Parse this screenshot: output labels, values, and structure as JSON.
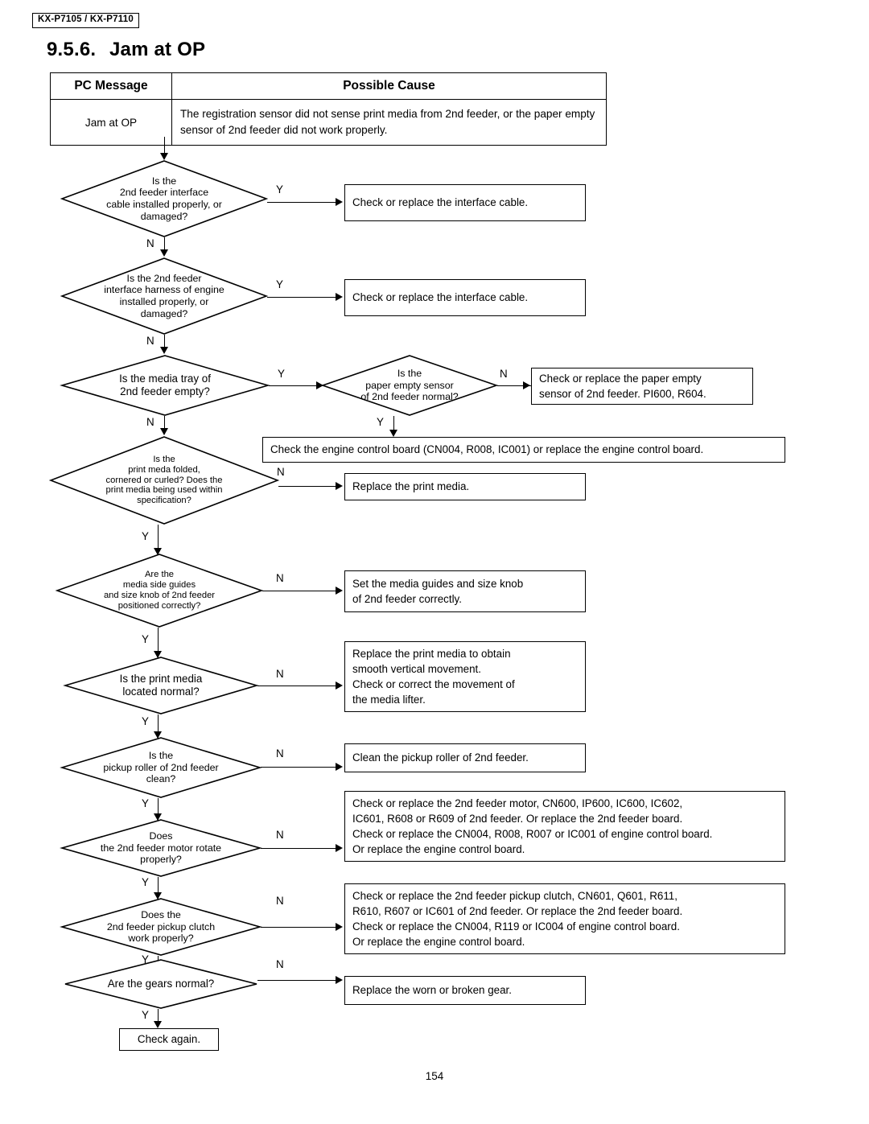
{
  "header": {
    "model_left": "KX-P7105",
    "model_sep": "/",
    "model_right": "KX-P7110",
    "section_number": "9.5.6.",
    "section_title": "Jam at OP"
  },
  "table": {
    "columns": [
      "PC Message",
      "Possible Cause"
    ],
    "rows": [
      {
        "pc_message": "Jam at OP",
        "possible_cause": "The registration sensor did not sense print media from 2nd feeder, or the paper empty sensor of 2nd feeder did not work properly."
      }
    ]
  },
  "flow": {
    "yes_label": "Y",
    "no_label": "N",
    "decisions": [
      {
        "id": "d1",
        "text": "Is the\n2nd feeder interface\ncable installed properly, or\ndamaged?"
      },
      {
        "id": "d2",
        "text": "Is the 2nd feeder\ninterface harness of engine\ninstalled properly, or\ndamaged?"
      },
      {
        "id": "d3",
        "text": "Is the media tray of\n2nd feeder empty?"
      },
      {
        "id": "d4",
        "text": "Is the\npaper empty sensor\nof 2nd feeder normal?"
      },
      {
        "id": "d5",
        "text": "Is the\nprint meda folded,\ncornered or curled? Does the\nprint media being used within\nspecification?"
      },
      {
        "id": "d6",
        "text": "Are the\nmedia side guides\nand size knob of 2nd feeder\npositioned correctly?"
      },
      {
        "id": "d7",
        "text": "Is the print media\nlocated normal?"
      },
      {
        "id": "d8",
        "text": "Is the\npickup roller of 2nd feeder\nclean?"
      },
      {
        "id": "d9",
        "text": "Does\nthe 2nd feeder motor rotate\nproperly?"
      },
      {
        "id": "d10",
        "text": "Does the\n2nd feeder pickup clutch\nwork properly?"
      },
      {
        "id": "d11",
        "text": "Are the gears normal?"
      }
    ],
    "actions": [
      {
        "id": "a1",
        "text": "Check or replace the interface cable."
      },
      {
        "id": "a2",
        "text": "Check or replace the interface cable."
      },
      {
        "id": "a3",
        "text": "Check or replace the paper empty\nsensor of 2nd feeder. PI600, R604."
      },
      {
        "id": "a4",
        "text": "Check the engine control board (CN004, R008, IC001) or replace the engine control board."
      },
      {
        "id": "a5",
        "text": "Replace the print media."
      },
      {
        "id": "a6",
        "text": "Set the media guides and size knob\nof 2nd feeder correctly."
      },
      {
        "id": "a7",
        "text": "Replace the print media to obtain\nsmooth vertical movement.\nCheck or correct the movement of\nthe media lifter."
      },
      {
        "id": "a8",
        "text": "Clean the pickup roller of 2nd feeder."
      },
      {
        "id": "a9",
        "text": "Check or replace the 2nd feeder motor, CN600, IP600, IC600, IC602,\nIC601, R608 or R609 of 2nd feeder. Or replace the 2nd feeder board.\nCheck or replace the CN004, R008, R007 or IC001 of engine control board.\nOr replace the engine control board."
      },
      {
        "id": "a10",
        "text": "Check or replace the 2nd feeder pickup clutch, CN601, Q601, R611,\nR610, R607 or IC601 of 2nd feeder. Or replace the 2nd feeder board.\nCheck or replace the CN004, R119 or IC004 of engine control board.\nOr replace the engine control board."
      },
      {
        "id": "a11",
        "text": "Replace the worn or broken gear."
      },
      {
        "id": "a12",
        "text": "Check again."
      }
    ]
  },
  "footer": {
    "page_number": "154"
  }
}
